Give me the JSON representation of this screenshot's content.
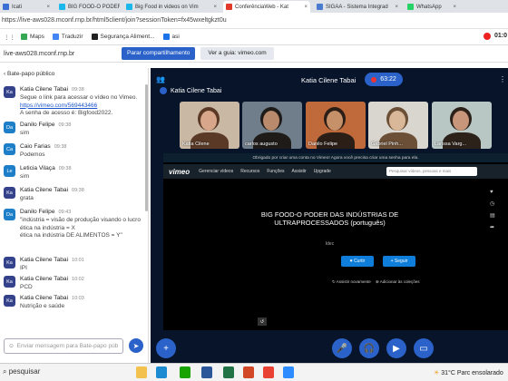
{
  "browser": {
    "tabs": [
      {
        "label": "Icati",
        "color": "#3b6fd6"
      },
      {
        "label": "BIG FOOD-O PODER D",
        "color": "#1ab7ea"
      },
      {
        "label": "Big Food in videos on Vim",
        "color": "#1ab7ea"
      },
      {
        "label": "ConferênciaWeb - Kat",
        "color": "#e23a2a"
      },
      {
        "label": "SIGAA - Sistema Integrad",
        "color": "#4a7bd0"
      },
      {
        "label": "WhatsApp",
        "color": "#25d366"
      }
    ],
    "address": "https://live-aws028.mconf.rnp.br/html5client/join?sessionToken=fx45wxeltgkzt0u",
    "bookmarks": [
      {
        "label": "Maps",
        "icon": "maps-icon",
        "color": "#34a853"
      },
      {
        "label": "Traduzir",
        "icon": "translate-icon",
        "color": "#4285f4"
      },
      {
        "label": "Segurança Aliment...",
        "icon": "bookmark-icon",
        "color": "#222"
      },
      {
        "label": "asi",
        "icon": "bookmark-icon",
        "color": "#1a73e8"
      }
    ],
    "record_time": "01:0"
  },
  "mconf": {
    "host": "live-aws028.mconf.rnp.br",
    "share_button": "Parar compartilhamento",
    "guide_button": "Ver a guia: vimeo.com"
  },
  "chat": {
    "header": "Bate-papo público",
    "messages": [
      {
        "initials": "Ka",
        "name": "Katia Cilene Tabai",
        "time": "09:38",
        "lines": [
          "Segue o link para acessar o vídeo no Vimeo.",
          "https://vimeo.com/569443466",
          "A senha de acesso é: Bigfood2022."
        ],
        "color": "#34428c"
      },
      {
        "initials": "Da",
        "name": "Danilo Felipe",
        "time": "09:38",
        "lines": [
          "sim"
        ],
        "color": "#1e7fc9"
      },
      {
        "initials": "Ca",
        "name": "Caio Farias",
        "time": "09:38",
        "lines": [
          "Podemos"
        ],
        "color": "#1e7fc9"
      },
      {
        "initials": "Le",
        "name": "Leticia Vilaça",
        "time": "09:38",
        "lines": [
          "sim"
        ],
        "color": "#1e7fc9"
      },
      {
        "initials": "Ka",
        "name": "Katia Cilene Tabai",
        "time": "09:38",
        "lines": [
          "grata"
        ],
        "color": "#34428c"
      },
      {
        "initials": "Da",
        "name": "Danilo Felipe",
        "time": "09:43",
        "lines": [
          "\"indústria = visão de produção visando o lucro",
          "ética na indústria = X",
          "ética na indústria DE ALIMENTOS = Y\""
        ],
        "color": "#1e7fc9"
      },
      {
        "initials": "Ka",
        "name": "Katia Cilene Tabai",
        "time": "10:01",
        "lines": [
          "IPI"
        ],
        "color": "#34428c"
      },
      {
        "initials": "Ka",
        "name": "Katia Cilene Tabai",
        "time": "10:02",
        "lines": [
          "PCD"
        ],
        "color": "#34428c"
      },
      {
        "initials": "Ka",
        "name": "Katia Cilene Tabai",
        "time": "10:03",
        "lines": [
          "Nutrição e saúde"
        ],
        "color": "#34428c"
      }
    ],
    "input_placeholder": "Enviar mensagem para Bate-papo púb"
  },
  "meeting": {
    "title": "Katia Cilene Tabai",
    "timer": "63:22",
    "presenter": "Katia Cilene Tabai",
    "participants": [
      {
        "name": "Katia Cilene",
        "bg": "#c9b8a4",
        "skin": "#d8a68a",
        "hair": "#5a3a26"
      },
      {
        "name": "carlos augusto",
        "bg": "#6f7e8a",
        "skin": "#b98a6c",
        "hair": "#1e1b19"
      },
      {
        "name": "Danilo Felipe",
        "bg": "#c06a3c",
        "skin": "#c69068",
        "hair": "#2b1e16"
      },
      {
        "name": "Gabriel Pinh...",
        "bg": "#d9d6cf",
        "skin": "#d9b89a",
        "hair": "#6b4f36"
      },
      {
        "name": "Larissa Varg...",
        "bg": "#b9c7c4",
        "skin": "#c8967a",
        "hair": "#2d221a"
      }
    ]
  },
  "vimeo": {
    "notice": "Obrigado por criar uma conta no Vimeo! Agora você precisa criar uma senha para ela.",
    "logo": "vimeo",
    "nav": [
      "Gerenciar vídeos",
      "Recursos",
      "Funções",
      "Assistir",
      "Upgrade"
    ],
    "search_placeholder": "Pesquisar vídeos, pessoas e mais",
    "video_title": "BIG FOOD-O PODER DAS INDÚSTRIAS DE ULTRAPROCESSADOS (português)",
    "video_author": "Idec",
    "like_button": "Curtir",
    "follow_button": "Seguir",
    "watch_later": "Assistir novamente",
    "add_collection": "Adicionar às coleções"
  },
  "taskbar": {
    "search": "pesquisar",
    "weather": "31°C  Parc ensolarado",
    "apps": [
      {
        "icon": "file-explorer-icon",
        "color": "#f2c14e"
      },
      {
        "icon": "edge-icon",
        "color": "#1d8bd1"
      },
      {
        "icon": "libreoffice-icon",
        "color": "#18a303"
      },
      {
        "icon": "word-icon",
        "color": "#2b579a"
      },
      {
        "icon": "excel-icon",
        "color": "#217346"
      },
      {
        "icon": "powerpoint-icon",
        "color": "#d24726"
      },
      {
        "icon": "chrome-icon",
        "color": "#e94235"
      },
      {
        "icon": "zoom-icon",
        "color": "#2d8cff"
      }
    ]
  }
}
